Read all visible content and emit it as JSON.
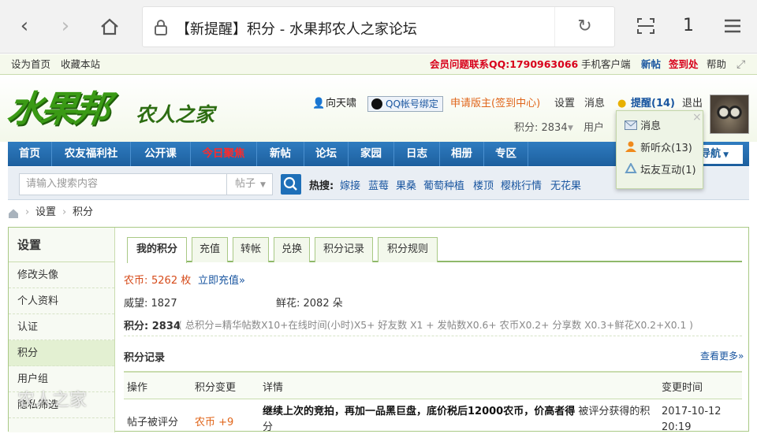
{
  "browser": {
    "tab_title": "【新提醒】积分 - 水果邦农人之家论坛",
    "tab_count": "1"
  },
  "topbar": {
    "set_home": "设为首页",
    "bookmark": "收藏本站",
    "contact": "会员问题联系QQ:1790963066",
    "mobile": "手机客户端",
    "new_post": "新帖",
    "checkin": "签到处",
    "help": "帮助"
  },
  "logo": {
    "main": "水果邦",
    "sub": "农人之家"
  },
  "user": {
    "name": "向天啸",
    "qq_bind": "QQ帐号绑定",
    "apply_mod": "申请版主(签到中心)",
    "settings": "设置",
    "messages": "消息",
    "alerts": "提醒(14)",
    "logout": "退出",
    "points": "积分: 2834",
    "group_prefix": "用户"
  },
  "dropdown": {
    "items": [
      "消息",
      "新听众(13)",
      "坛友互动(1)"
    ]
  },
  "nav": {
    "items": [
      "首页",
      "农友福利社",
      "公开课",
      "今日聚焦",
      "新帖",
      "论坛",
      "家园",
      "日志",
      "相册",
      "专区"
    ],
    "quick_nav": "导航"
  },
  "search": {
    "placeholder": "请输入搜索内容",
    "type": "帖子",
    "hot_label": "热搜:",
    "hot": [
      "嫁接",
      "蓝莓",
      "果桑",
      "葡萄种植",
      "楼顶",
      "樱桃行情",
      "无花果"
    ]
  },
  "breadcrumb": [
    "设置",
    "积分"
  ],
  "sidebar": {
    "title": "设置",
    "items": [
      "修改头像",
      "个人资料",
      "认证",
      "积分",
      "用户组",
      "隐私筛选"
    ]
  },
  "tabs": [
    "我的积分",
    "充值",
    "转帐",
    "兑换",
    "积分记录",
    "积分规则"
  ],
  "credits": {
    "coin_label": "农币:",
    "coin_value": "5262 枚",
    "recharge": "立即充值»",
    "prestige": "威望: 1827",
    "flowers": "鲜花: 2082 朵",
    "total_label": "积分: 2834",
    "formula": "( 总积分=精华帖数X10+在线时间(小时)X5+ 好友数 X1 + 发帖数X0.6+ 农币X0.2+ 分享数 X0.3+鲜花X0.2+X0.1 )"
  },
  "records": {
    "title": "积分记录",
    "more": "查看更多»",
    "columns": [
      "操作",
      "积分变更",
      "详情",
      "变更时间"
    ],
    "rows": [
      {
        "op": "帖子被评分",
        "change": "农币 +9",
        "detail_bold": "继续上次的竞拍，再加一品黑巨盘，底价税后12000农币，价高者得",
        "detail_tail": "被评分获得的积分",
        "time": "2017-10-12 20:19"
      }
    ]
  },
  "watermark": "农人之家",
  "colors": {
    "nav_blue": "#1d5f9e",
    "green_accent": "#3a9a15",
    "red": "#d8001b",
    "link_blue": "#1a56a0",
    "orange": "#e0651a"
  }
}
